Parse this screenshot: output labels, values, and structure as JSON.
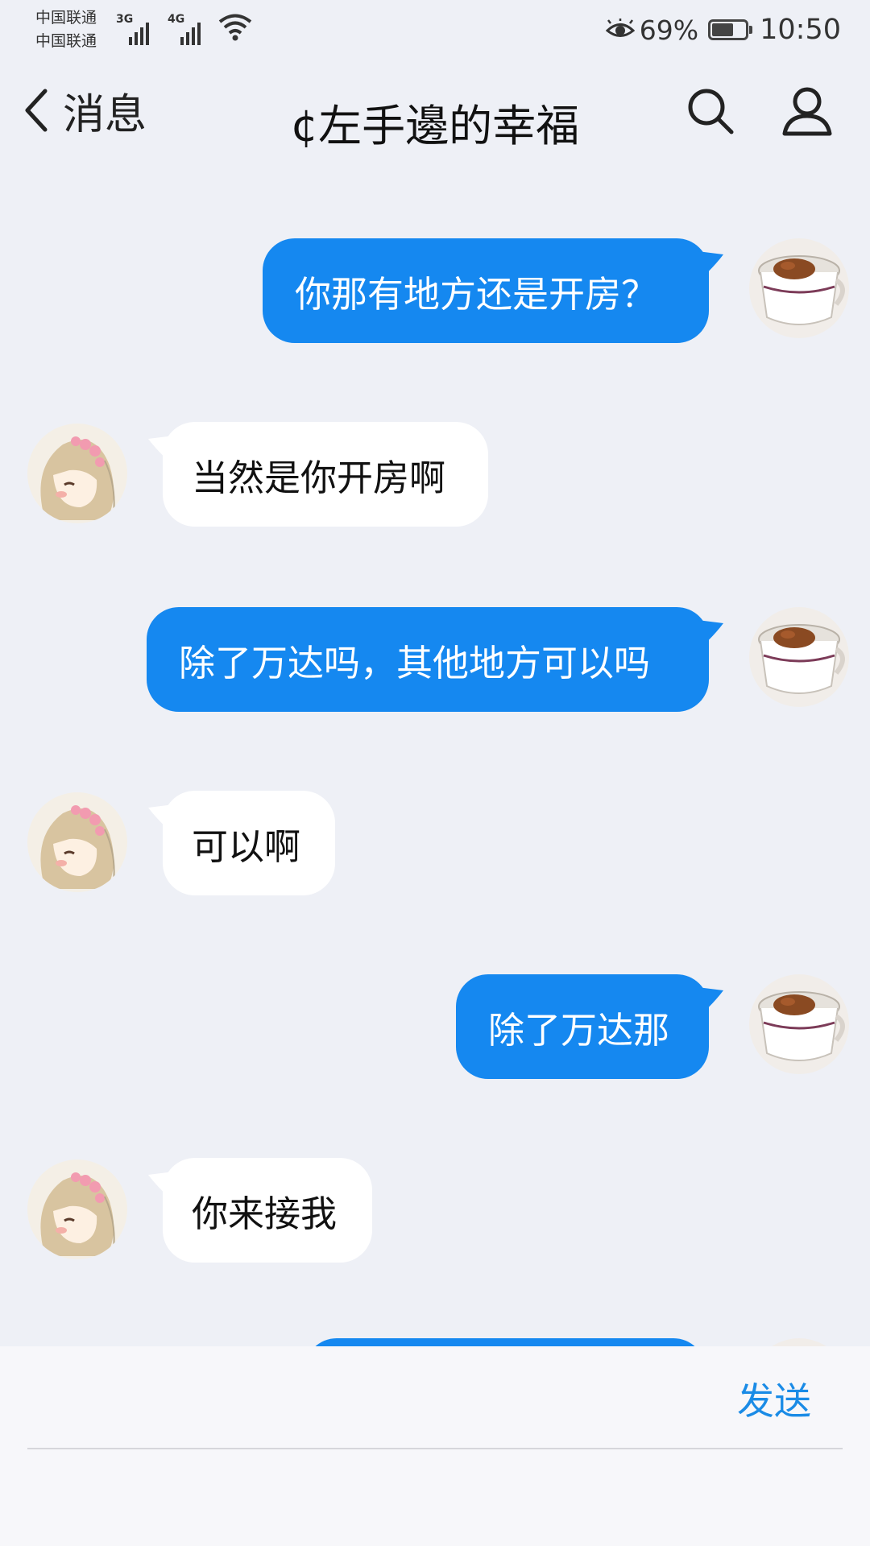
{
  "status_bar": {
    "carrier_1": "中国联通",
    "carrier_2": "中国联通",
    "network_1": "3G",
    "network_2": "4G",
    "battery_percent": "69%",
    "battery_level": 0.69,
    "time": "10:50"
  },
  "nav": {
    "back_label": "消息",
    "title": "¢左手邊的幸福"
  },
  "messages": [
    {
      "side": "out",
      "text": "你那有地方还是开房？"
    },
    {
      "side": "in",
      "text": "当然是你开房啊"
    },
    {
      "side": "out",
      "text": "除了万达吗，其他地方可以吗"
    },
    {
      "side": "in",
      "text": "可以啊"
    },
    {
      "side": "out",
      "text": "除了万达那"
    },
    {
      "side": "in",
      "text": "你来接我"
    },
    {
      "side": "out",
      "text": ""
    }
  ],
  "input": {
    "value": "",
    "send_label": "发送"
  },
  "colors": {
    "outgoing_bubble": "#1588f0",
    "incoming_bubble": "#ffffff",
    "background": "#eef0f6",
    "send_text": "#1a8be6"
  },
  "icons": {
    "back": "chevron-left-icon",
    "search": "search-icon",
    "profile": "person-icon",
    "eye": "eye-comfort-icon",
    "wifi": "wifi-icon",
    "battery": "battery-icon"
  }
}
